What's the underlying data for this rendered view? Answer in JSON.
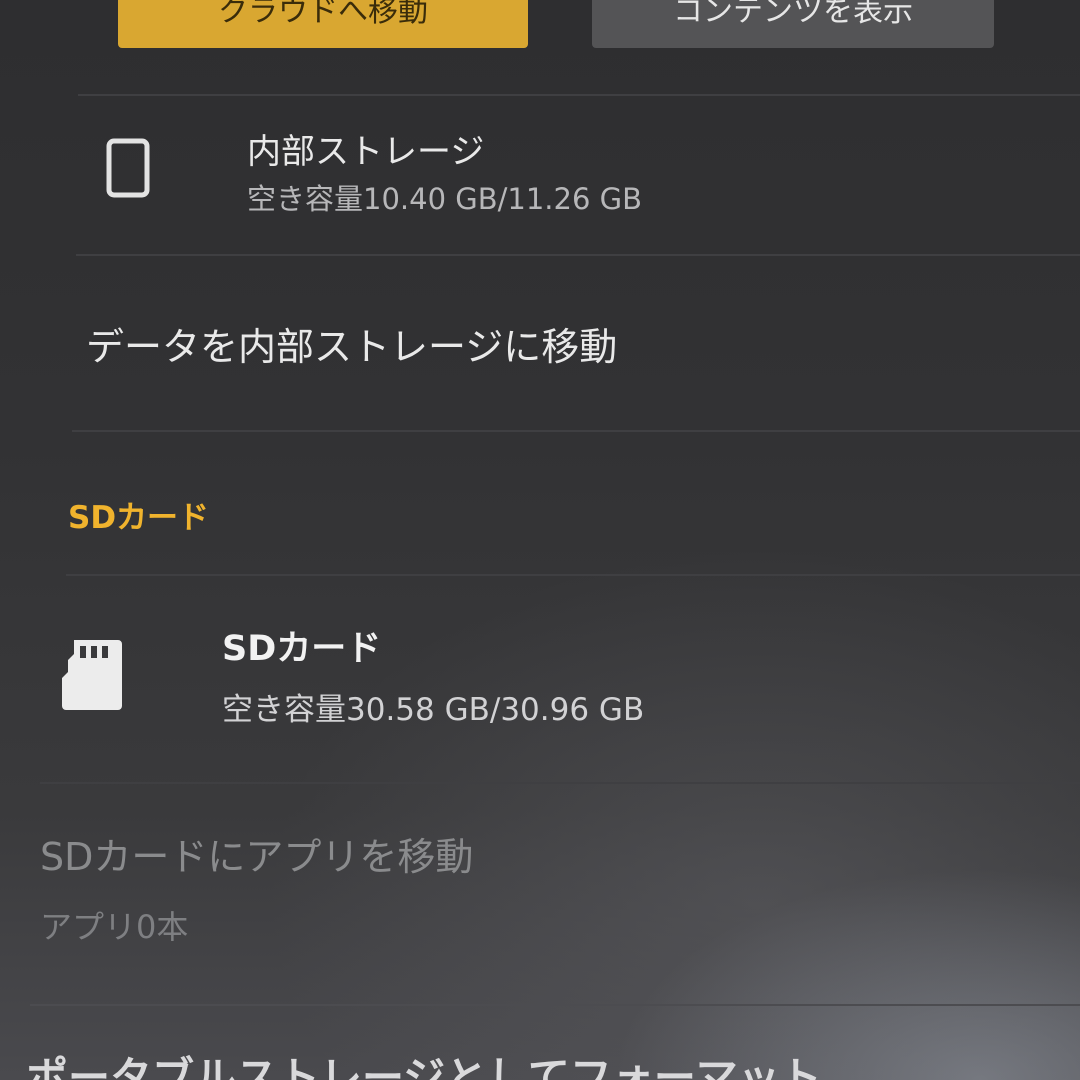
{
  "top_buttons": {
    "move_to_cloud": "クラウドへ移動",
    "show_content": "コンテンツを表示"
  },
  "internal_storage": {
    "icon": "phone-icon",
    "title": "内部ストレージ",
    "free_space": "空き容量10.40 GB/11.26 GB"
  },
  "move_data_internal": {
    "label": "データを内部ストレージに移動"
  },
  "sd_section": {
    "header": "SDカード"
  },
  "sd_card": {
    "icon": "sd-card-icon",
    "title": "SDカード",
    "free_space": "空き容量30.58 GB/30.96 GB"
  },
  "move_apps_sd": {
    "title": "SDカードにアプリを移動",
    "subtitle": "アプリ0本"
  },
  "format_portable": {
    "title": "ポータブルストレージとしてフォーマット"
  },
  "colors": {
    "accent": "#f0b32d",
    "button_cloud": "#d9a731",
    "button_content": "#545456",
    "background": "#2e2e30"
  }
}
